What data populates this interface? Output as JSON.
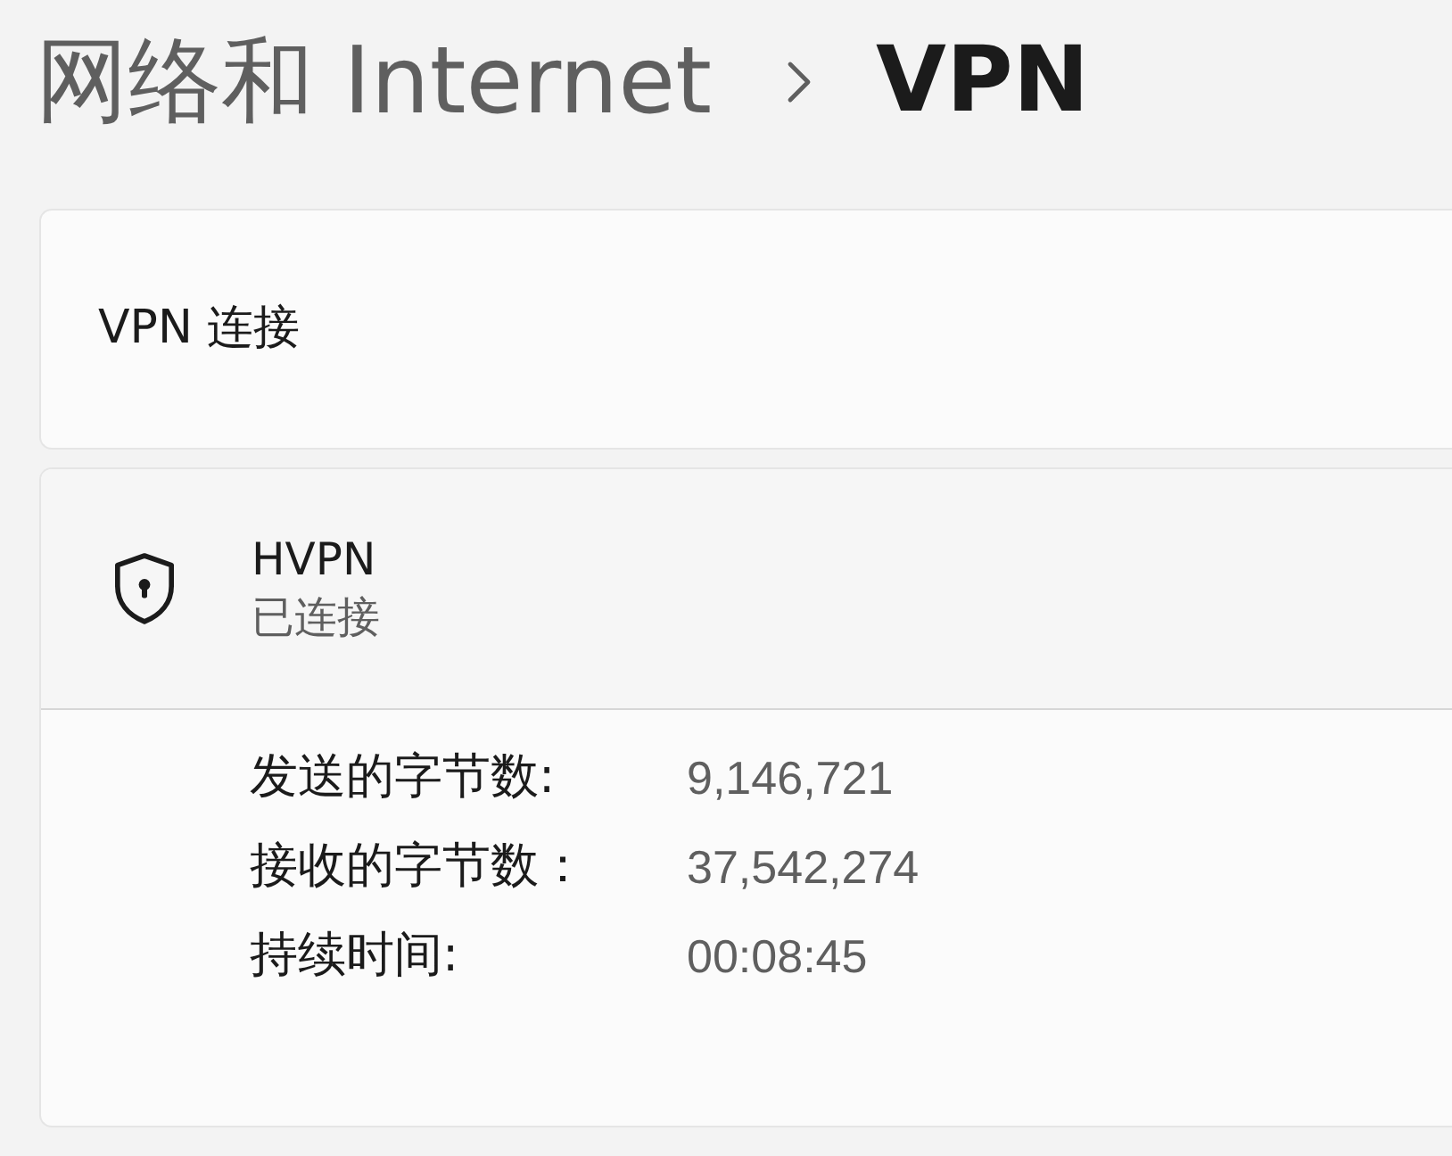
{
  "breadcrumb": {
    "parent": "网络和 Internet",
    "current": "VPN"
  },
  "section": {
    "title": "VPN 连接"
  },
  "connections": [
    {
      "name": "HVPN",
      "status": "已连接",
      "expanded": true,
      "details": [
        {
          "label": "发送的字节数:",
          "value": "9,146,721"
        },
        {
          "label": "接收的字节数：",
          "value": "37,542,274"
        },
        {
          "label": "持续时间:",
          "value": "00:08:45"
        }
      ]
    }
  ]
}
